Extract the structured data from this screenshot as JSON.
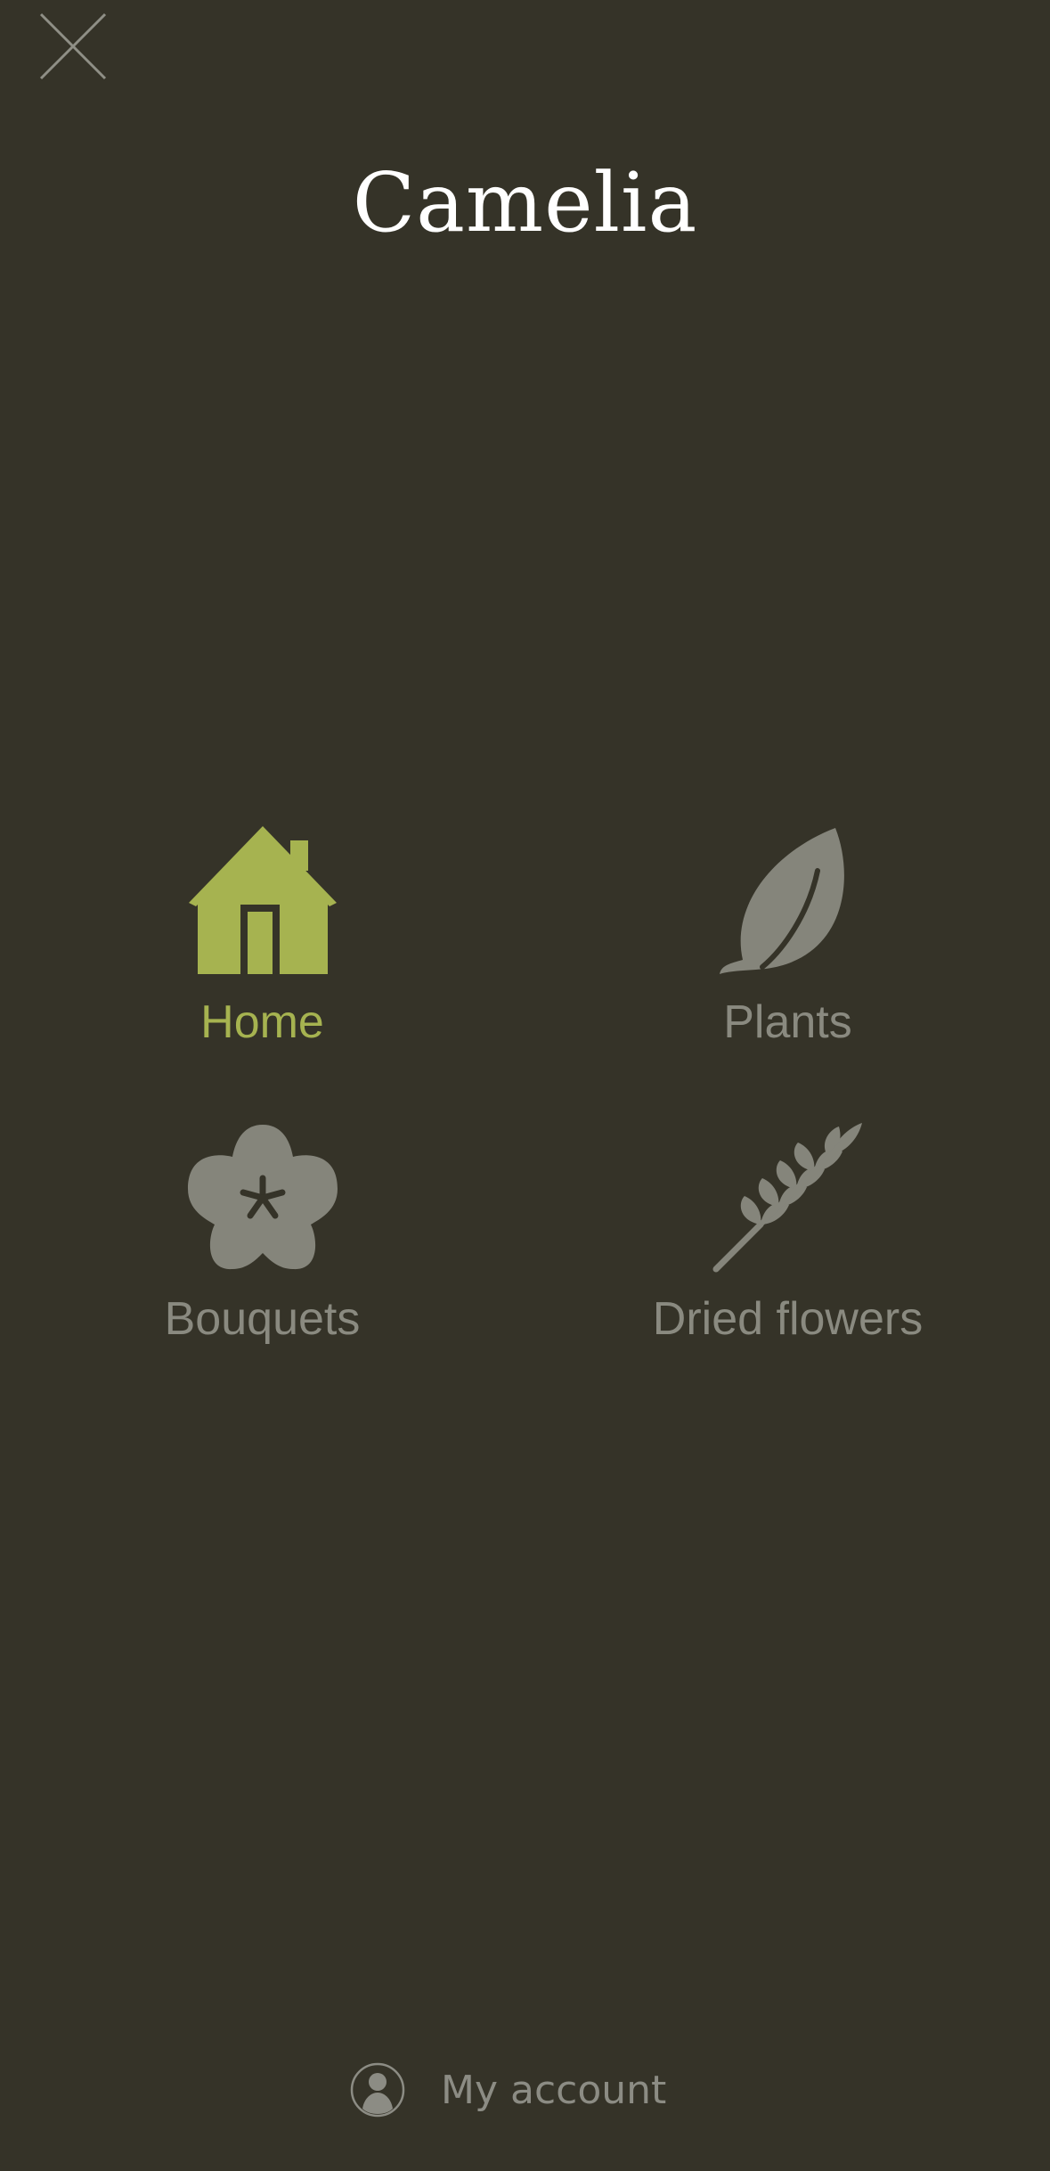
{
  "app": {
    "title": "Camelia"
  },
  "colors": {
    "background": "#353328",
    "active": "#a6b350",
    "inactive": "#8a8a80",
    "title": "#ffffff"
  },
  "close": {
    "icon": "close-icon"
  },
  "nav": {
    "items": [
      {
        "id": "home",
        "label": "Home",
        "icon": "house-icon",
        "active": true
      },
      {
        "id": "plants",
        "label": "Plants",
        "icon": "leaf-icon",
        "active": false
      },
      {
        "id": "bouquets",
        "label": "Bouquets",
        "icon": "flower-icon",
        "active": false
      },
      {
        "id": "dried",
        "label": "Dried flowers",
        "icon": "wheat-icon",
        "active": false
      }
    ]
  },
  "account": {
    "label": "My account",
    "icon": "user-avatar-icon"
  }
}
